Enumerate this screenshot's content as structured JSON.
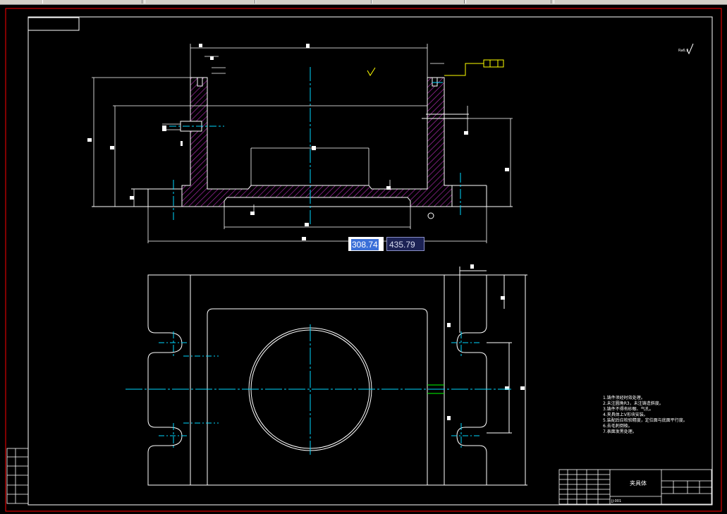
{
  "app": {
    "toolbar_segments": [
      "",
      "",
      "",
      "",
      "",
      ""
    ]
  },
  "drawing": {
    "colors": {
      "border": "#ff0000",
      "line": "#ffffff",
      "center": "#00d8ff",
      "hatch": "#c030c0",
      "dim": "#ffffff",
      "highlight": "#00ff00"
    },
    "roughness_symbol": "Ra6.3",
    "title_block": {
      "part_name": "夹具体",
      "drawing_no": "JJ-001"
    },
    "notes": [
      "1.铸件须经时效处理。",
      "2.未注圆角R3，未注铸造斜度。",
      "3.铸件不得有砂眼、气孔。",
      "4.夹具体上V形块安装。",
      "5.装配后应检验精度，定位面与底面平行度。",
      "6.去毛刺倒棱。",
      "7.表面发黑处理。"
    ]
  },
  "cursor_input": {
    "x": "308.74",
    "y": "435.79"
  }
}
